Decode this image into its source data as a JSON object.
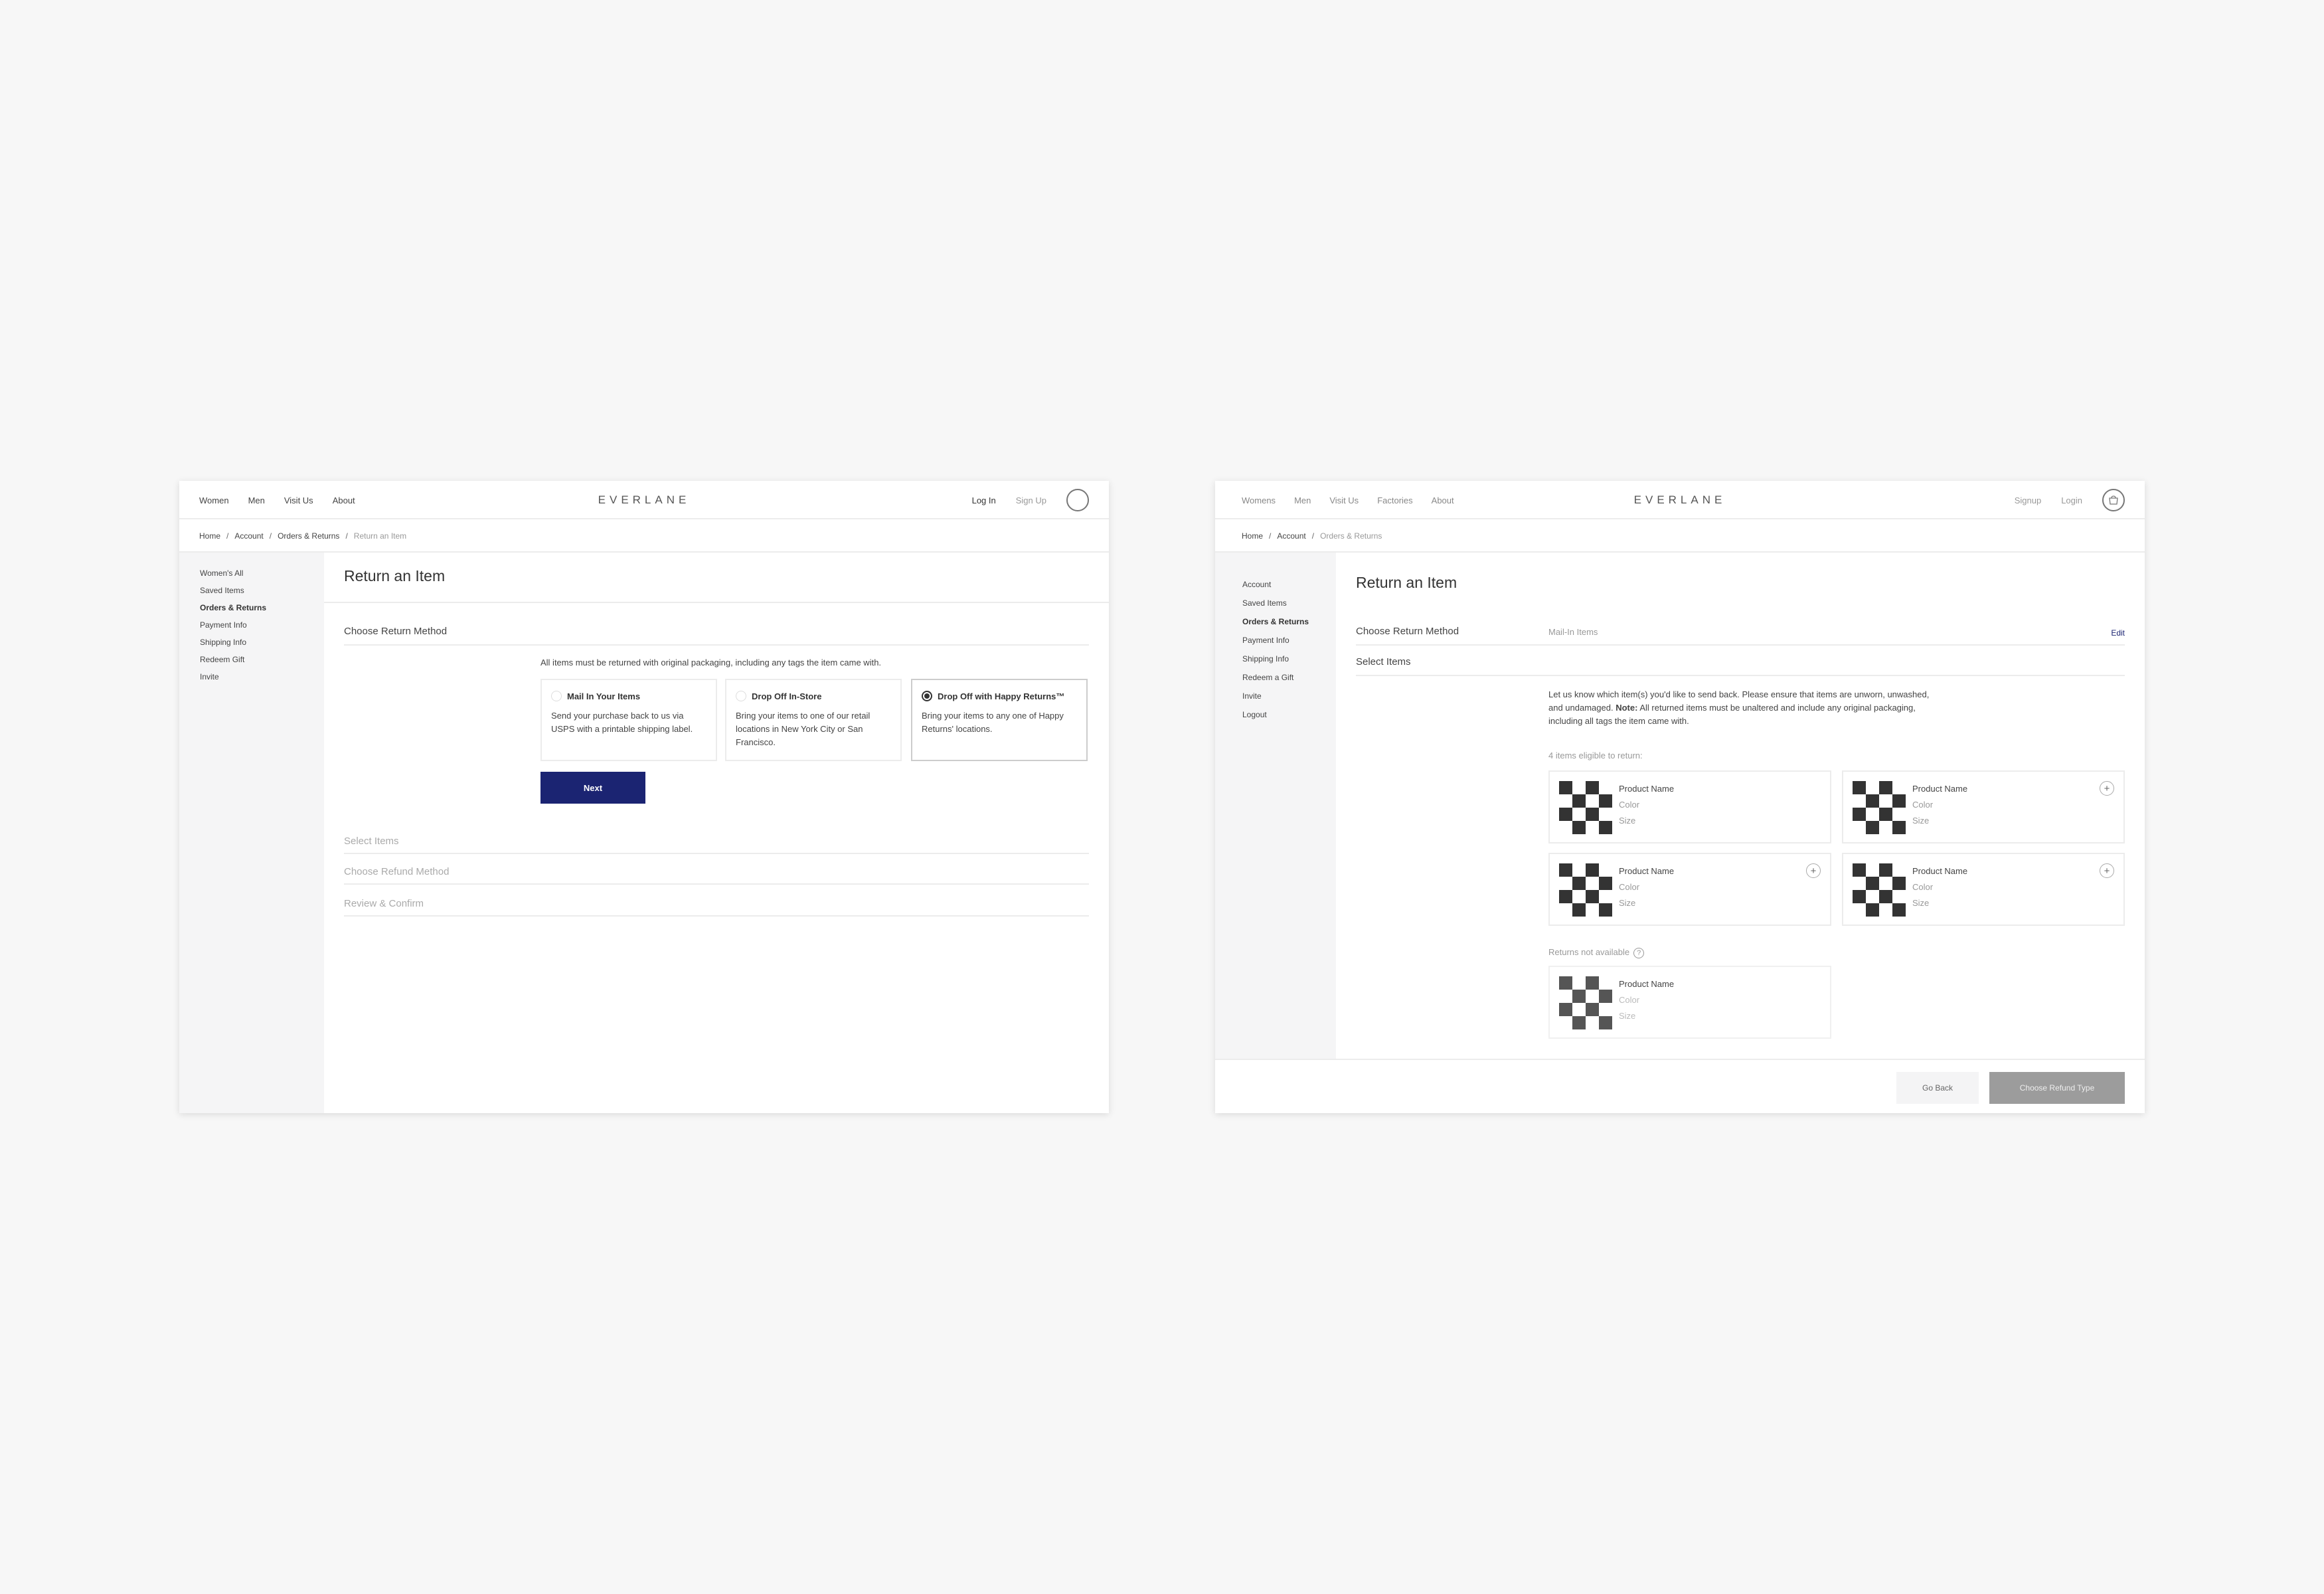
{
  "screen1": {
    "nav": [
      "Women",
      "Men",
      "Visit Us",
      "About"
    ],
    "logo": "EVERLANE",
    "login": "Log In",
    "signup": "Sign Up",
    "breadcrumb": [
      "Home",
      "Account",
      "Orders & Returns",
      "Return an Item"
    ],
    "sidebar": [
      "Women's All",
      "Saved Items",
      "Orders & Returns",
      "Payment Info",
      "Shipping Info",
      "Redeem Gift",
      "Invite"
    ],
    "active_sidebar": "Orders & Returns",
    "title": "Return an Item",
    "section_return_method": "Choose Return Method",
    "packaging_note": "All items must be returned with original packaging, including any tags the item came with.",
    "options": [
      {
        "title": "Mail In Your Items",
        "desc": "Send your purchase back to us via USPS with a printable shipping label.",
        "selected": false
      },
      {
        "title": "Drop Off In-Store",
        "desc": "Bring your items to one of our retail locations in New York City or San Francisco.",
        "selected": false
      },
      {
        "title": "Drop Off with Happy Returns™",
        "desc": "Bring your items to any one of Happy Returns' locations.",
        "selected": true
      }
    ],
    "next_label": "Next",
    "steps": [
      "Select Items",
      "Choose Refund Method",
      "Review & Confirm"
    ]
  },
  "screen2": {
    "nav": [
      "Womens",
      "Men",
      "Visit Us",
      "Factories",
      "About"
    ],
    "logo": "EVERLANE",
    "signup": "Signup",
    "login": "Login",
    "breadcrumb": [
      "Home",
      "Account",
      "Orders & Returns"
    ],
    "sidebar": [
      "Account",
      "Saved Items",
      "Orders & Returns",
      "Payment Info",
      "Shipping Info",
      "Redeem a Gift",
      "Invite",
      "Logout"
    ],
    "active_sidebar": "Orders & Returns",
    "title": "Return an Item",
    "section_return_method": "Choose Return Method",
    "return_method_value": "Mail-In Items",
    "edit_label": "Edit",
    "section_select_items": "Select Items",
    "instructions_1": "Let us know which item(s) you'd like to send back. Please ensure that items are unworn, unwashed, and undamaged.",
    "note_label": "Note:",
    "instructions_2": "All returned items must be unaltered and include any original packaging, including all tags the item came with.",
    "eligible_label": "4 items eligible to return:",
    "eligible_items": [
      {
        "name": "Product Name",
        "color": "Color",
        "size": "Size",
        "add": false
      },
      {
        "name": "Product Name",
        "color": "Color",
        "size": "Size",
        "add": true
      },
      {
        "name": "Product Name",
        "color": "Color",
        "size": "Size",
        "add": true
      },
      {
        "name": "Product Name",
        "color": "Color",
        "size": "Size",
        "add": true
      }
    ],
    "not_available_label": "Returns not available",
    "help_glyph": "?",
    "unavailable_items": [
      {
        "name": "Product Name",
        "color": "Color",
        "size": "Size"
      }
    ],
    "plus_glyph": "+",
    "go_back_label": "Go Back",
    "choose_refund_label": "Choose Refund Type"
  }
}
